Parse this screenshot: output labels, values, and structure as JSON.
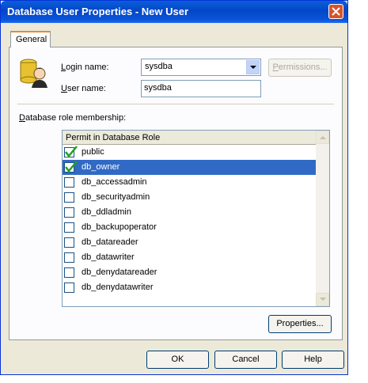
{
  "window": {
    "title": "Database User Properties - New User"
  },
  "tabs": [
    {
      "label": "General"
    }
  ],
  "form": {
    "login_label_accel": "L",
    "login_label_rest": "ogin name:",
    "login_value": "sysdba",
    "user_label_accel": "U",
    "user_label_rest": "ser name:",
    "user_value": "sysdba",
    "permissions_accel": "P",
    "permissions_rest": "ermissions..."
  },
  "roles": {
    "label_accel": "D",
    "label_rest": "atabase role membership:",
    "header": "Permit in Database Role",
    "items": [
      {
        "name": "public",
        "checked": true
      },
      {
        "name": "db_owner",
        "checked": true,
        "selected": true
      },
      {
        "name": "db_accessadmin",
        "checked": false
      },
      {
        "name": "db_securityadmin",
        "checked": false
      },
      {
        "name": "db_ddladmin",
        "checked": false
      },
      {
        "name": "db_backupoperator",
        "checked": false
      },
      {
        "name": "db_datareader",
        "checked": false
      },
      {
        "name": "db_datawriter",
        "checked": false
      },
      {
        "name": "db_denydatareader",
        "checked": false
      },
      {
        "name": "db_denydatawriter",
        "checked": false
      }
    ],
    "properties_label": "Properties..."
  },
  "buttons": {
    "ok": "OK",
    "cancel": "Cancel",
    "help": "Help"
  },
  "icons": {
    "close": "close-icon",
    "user": "database-user-icon",
    "dropdown": "chevron-down-icon",
    "check": "checkmark-icon"
  },
  "colors": {
    "title_bar": "#0a54d8",
    "selection": "#316ac5",
    "check": "#21a121"
  }
}
